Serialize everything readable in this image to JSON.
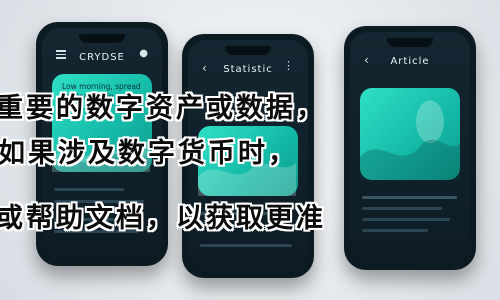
{
  "phones": {
    "left": {
      "title": "CRYDSE",
      "card_text": "Low morning, spread the leading in a Brad..."
    },
    "middle": {
      "title": "Statistic"
    },
    "right": {
      "title": "Article"
    }
  },
  "overlay": {
    "line1": "重要的数字资产或数据，",
    "line2": "如果涉及数字货币时，",
    "line3": "或帮助文档，以获取更准"
  },
  "colors": {
    "teal": "#14b8a6",
    "phone_dark": "#0c1a22"
  }
}
